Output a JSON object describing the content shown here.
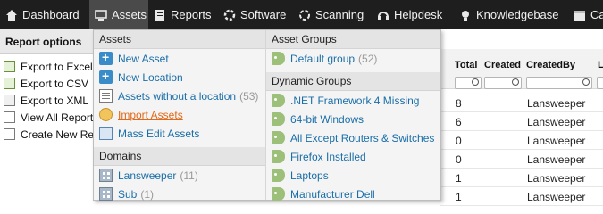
{
  "nav": [
    {
      "label": "Dashboard",
      "icon": "home-icon"
    },
    {
      "label": "Assets",
      "icon": "monitor-icon",
      "active": true
    },
    {
      "label": "Reports",
      "icon": "report-icon"
    },
    {
      "label": "Software",
      "icon": "software-icon"
    },
    {
      "label": "Scanning",
      "icon": "scanning-icon"
    },
    {
      "label": "Helpdesk",
      "icon": "headset-icon"
    },
    {
      "label": "Knowledgebase",
      "icon": "bulb-icon"
    },
    {
      "label": "Ca",
      "icon": "calendar-icon"
    }
  ],
  "report_options": {
    "title": "Report options",
    "items": [
      {
        "label": "Export to Excel"
      },
      {
        "label": "Export to CSV"
      },
      {
        "label": "Export to XML"
      },
      {
        "label": "View All Reports"
      },
      {
        "label": "Create New Report"
      }
    ]
  },
  "dropdown": {
    "assets": {
      "header": "Assets",
      "items": [
        {
          "label": "New Asset",
          "count": ""
        },
        {
          "label": "New Location",
          "count": ""
        },
        {
          "label": "Assets without a location",
          "count": "(53)"
        },
        {
          "label": "Import Assets",
          "count": ""
        },
        {
          "label": "Mass Edit Assets",
          "count": ""
        }
      ]
    },
    "domains": {
      "header": "Domains",
      "items": [
        {
          "label": "Lansweeper",
          "count": "(11)"
        },
        {
          "label": "Sub",
          "count": "(1)"
        }
      ]
    },
    "asset_groups": {
      "header": "Asset Groups",
      "items": [
        {
          "label": "Default group",
          "count": "(52)"
        }
      ]
    },
    "dynamic_groups": {
      "header": "Dynamic Groups",
      "items": [
        {
          "label": ".NET Framework 4 Missing"
        },
        {
          "label": "64-bit Windows"
        },
        {
          "label": "All Except Routers & Switches"
        },
        {
          "label": "Firefox Installed"
        },
        {
          "label": "Laptops"
        },
        {
          "label": "Manufacturer Dell"
        }
      ]
    }
  },
  "table": {
    "columns": [
      "Total",
      "Created",
      "CreatedBy",
      "L"
    ],
    "rows": [
      {
        "total": "8",
        "createdby": "Lansweeper"
      },
      {
        "total": "6",
        "createdby": "Lansweeper"
      },
      {
        "total": "0",
        "createdby": "Lansweeper"
      },
      {
        "total": "0",
        "createdby": "Lansweeper"
      },
      {
        "total": "1",
        "createdby": "Lansweeper"
      },
      {
        "total": "1",
        "createdby": "Lansweeper"
      }
    ]
  },
  "colors": {
    "nav_bg": "#1e1e1e",
    "nav_active": "#4a4a4a",
    "link": "#1a6ea8",
    "link_hover": "#e06a1b",
    "menu_bg": "#f4f4f4"
  }
}
